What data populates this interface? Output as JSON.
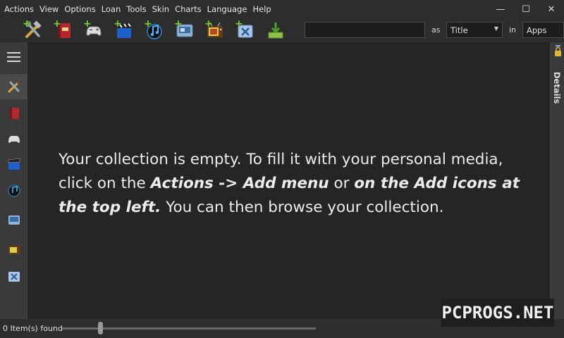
{
  "menu": {
    "items": [
      "Actions",
      "View",
      "Options",
      "Loan",
      "Tools",
      "Skin",
      "Charts",
      "Language",
      "Help"
    ]
  },
  "window_controls": {
    "minimize": "—",
    "maximize": "☐",
    "close": "✕"
  },
  "toolbar": {
    "icons": [
      "add-apps-icon",
      "add-books-icon",
      "add-games-icon",
      "add-movies-icon",
      "add-music-icon",
      "add-software-icon",
      "add-tv-icon",
      "add-other-icon",
      "import-icon"
    ],
    "search": {
      "value": "",
      "placeholder": ""
    },
    "as_label": "as",
    "as_select": "Title",
    "in_label": "in",
    "in_select": "Apps"
  },
  "sidebar": {
    "icons": [
      "apps-icon",
      "books-icon",
      "games-icon",
      "movies-icon",
      "music-icon",
      "software-icon",
      "tv-icon",
      "other-icon"
    ]
  },
  "main": {
    "msg_part1": "Your collection is empty. To fill it with your personal media, click on the ",
    "msg_bold1": "Actions -> Add menu",
    "msg_part2": " or ",
    "msg_bold2": "on the Add icons at the top left.",
    "msg_part3": " You can then browse your collection."
  },
  "details": {
    "label": "Details"
  },
  "status": {
    "items_found": "0 Item(s) found",
    "zoom_level": 0.15
  },
  "watermark": "PCPROGS.NET"
}
